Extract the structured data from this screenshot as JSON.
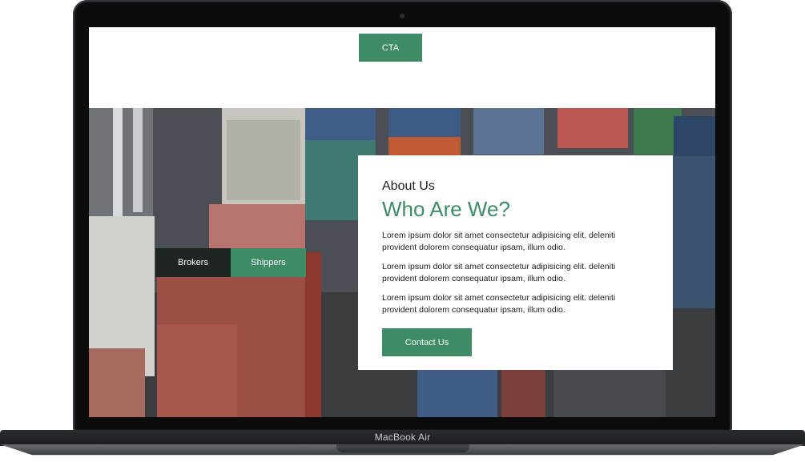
{
  "header": {
    "cta_label": "CTA"
  },
  "hero": {
    "tabs": [
      {
        "label": "Brokers"
      },
      {
        "label": "Shippers"
      }
    ]
  },
  "about": {
    "kicker": "About Us",
    "title": "Who Are We?",
    "paragraphs": [
      "Lorem ipsum dolor sit amet consectetur adipisicing elit. deleniti provident dolorem consequatur ipsam, illum odio.",
      "Lorem ipsum dolor sit amet consectetur adipisicing elit. deleniti provident dolorem consequatur ipsam, illum odio.",
      "Lorem ipsum dolor sit amet consectetur adipisicing elit. deleniti provident dolorem consequatur ipsam, illum odio."
    ],
    "contact_label": "Contact Us"
  },
  "device": {
    "brand_label": "MacBook Air"
  },
  "colors": {
    "accent": "#3d8c66",
    "dark_tab": "#1e2421"
  }
}
